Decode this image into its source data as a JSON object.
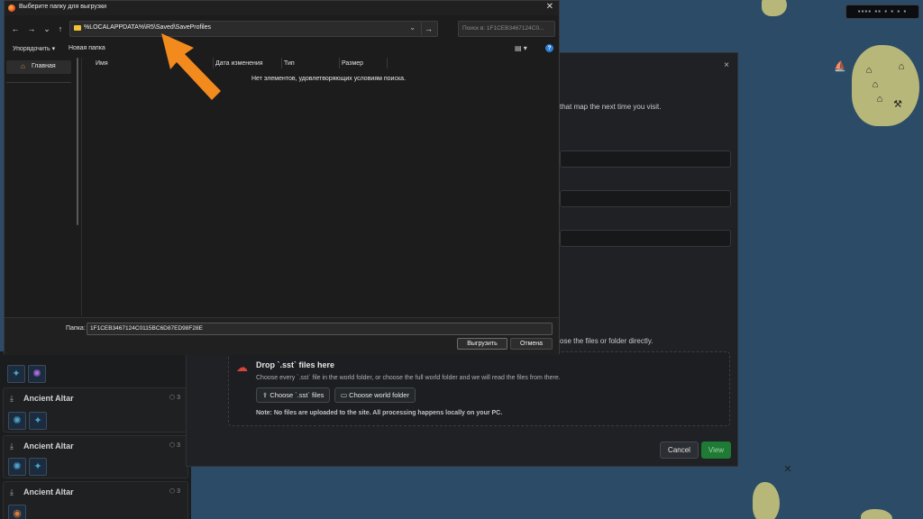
{
  "map": {
    "pill_text": "▪▪▪▪ ▪▪ ▪ ▪ ▪ ▪"
  },
  "left_panel": {
    "cards": [
      {
        "title": "Ancient Altar",
        "badge": "⬡ 3"
      },
      {
        "title": "Ancient Altar",
        "badge": "⬡ 3"
      },
      {
        "title": "Ancient Altar",
        "badge": "⬡ 3"
      }
    ]
  },
  "web_modal": {
    "close": "×",
    "hint_top": "that map the next time you visit.",
    "hint_mid": "ose the files or folder directly.",
    "drop_title": "Drop `.sst` files here",
    "drop_desc": "Choose every `.sst` file in the world folder, or choose the full world folder and we will read the files from there.",
    "choose_files": "Choose `.sst` files",
    "choose_folder": "Choose world folder",
    "note": "Note: No files are uploaded to the site. All processing happens locally on your PC.",
    "cancel": "Cancel",
    "view": "View"
  },
  "dialog": {
    "title": "Выберите папку для выгрузки",
    "close": "✕",
    "address": "%LOCALAPPDATA%\\R5\\Saved\\SaveProfiles",
    "search_placeholder": "Поиск в: 1F1CEB3467124C0...",
    "toolbar": {
      "organize": "Упорядочить ▾",
      "new_folder": "Новая папка"
    },
    "sidebar": {
      "home": "Главная"
    },
    "columns": [
      "Имя",
      "Дата изменения",
      "Тип",
      "Размер"
    ],
    "empty_message": "Нет элементов, удовлетворяющих условиям поиска.",
    "folder_label": "Папка:",
    "folder_value": "1F1CEB3467124C0115BC6D87ED98F28E",
    "select_button": "Выгрузить",
    "cancel_button": "Отмена",
    "help": "?"
  },
  "colors": {
    "accent_arrow": "#f28a1e",
    "view_button": "#1e7a34",
    "folder": "#f1c232",
    "drop_icon": "#d8433a"
  }
}
